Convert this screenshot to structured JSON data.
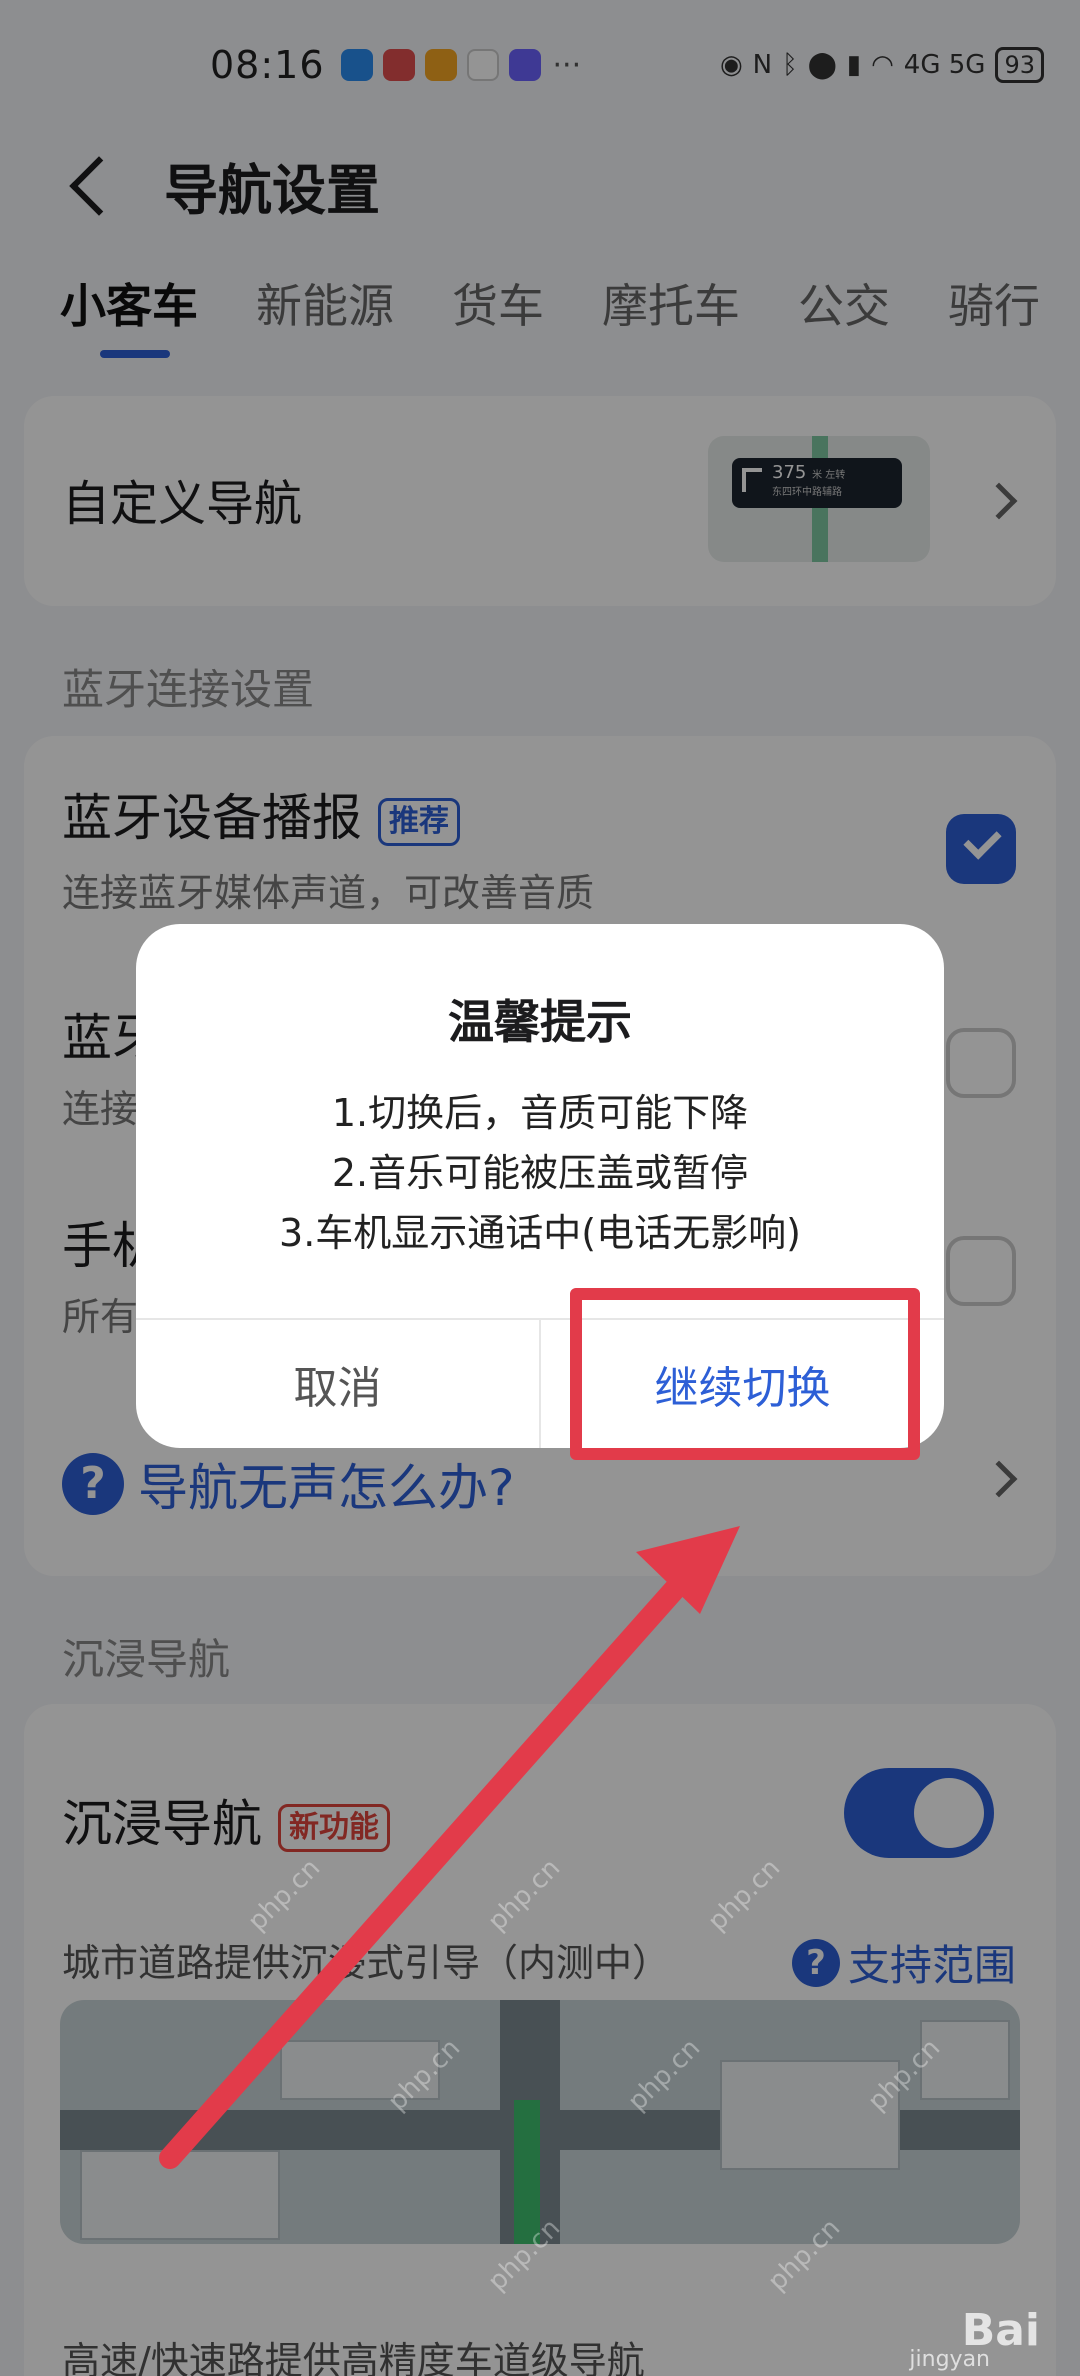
{
  "status_bar": {
    "time": "08:16",
    "more": "···",
    "network": "4G 5G",
    "battery": "93"
  },
  "header": {
    "title": "导航设置"
  },
  "tabs": [
    {
      "label": "小客车"
    },
    {
      "label": "新能源"
    },
    {
      "label": "货车"
    },
    {
      "label": "摩托车"
    },
    {
      "label": "公交"
    },
    {
      "label": "骑行"
    }
  ],
  "custom_nav": {
    "title": "自定义导航",
    "preview_distance": "375",
    "preview_unit": "米 左转",
    "preview_road": "东四环中路辅路"
  },
  "bluetooth_section": {
    "label": "蓝牙连接设置",
    "row1_title": "蓝牙设备播报",
    "row1_badge": "推荐",
    "row1_sub": "连接蓝牙媒体声道，可改善音质",
    "row2_title": "蓝牙",
    "row2_sub": "连接",
    "row3_title": "手机",
    "row3_sub": "所有",
    "help_text": "导航无声怎么办?"
  },
  "immersive_section": {
    "label": "沉浸导航",
    "title": "沉浸导航",
    "badge": "新功能",
    "desc": "城市道路提供沉浸式引导（内测中）",
    "support_link": "支持范围",
    "desc2": "高速/快速路提供高精度车道级导航"
  },
  "dialog": {
    "title": "温馨提示",
    "line1": "1.切换后，音质可能下降",
    "line2": "2.音乐可能被压盖或暂停",
    "line3": "3.车机显示通话中(电话无影响)",
    "cancel_label": "取消",
    "confirm_label": "继续切换"
  },
  "watermark": {
    "site": "php.cn",
    "brand": "Bai",
    "brand_sub": "jingyan"
  },
  "colors": {
    "accent": "#2d5fd6",
    "annotation_red": "#e23b4a"
  }
}
